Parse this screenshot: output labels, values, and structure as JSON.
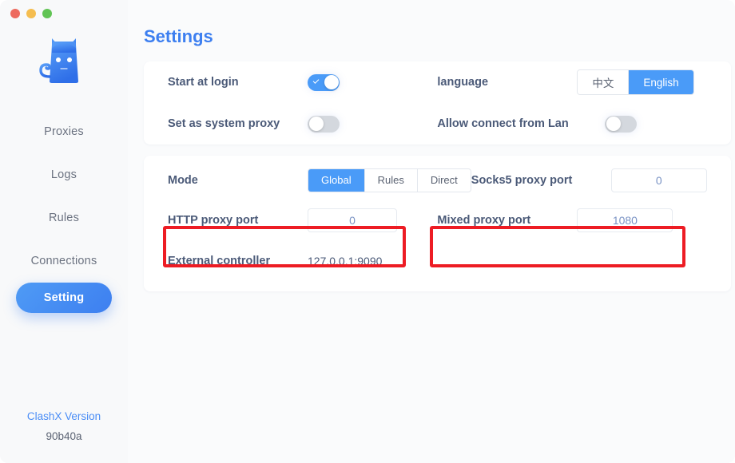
{
  "window": {
    "traffic_lights": [
      {
        "name": "close",
        "color": "#ed6a5e"
      },
      {
        "name": "minimize",
        "color": "#f5bd4f"
      },
      {
        "name": "zoom",
        "color": "#61c454"
      }
    ]
  },
  "sidebar": {
    "logo": "clashx-cat-logo",
    "items": [
      {
        "label": "Proxies",
        "active": false
      },
      {
        "label": "Logs",
        "active": false
      },
      {
        "label": "Rules",
        "active": false
      },
      {
        "label": "Connections",
        "active": false
      },
      {
        "label": "Setting",
        "active": true
      }
    ],
    "version_label": "ClashX Version",
    "version_hash": "90b40a"
  },
  "main": {
    "title": "Settings",
    "card_general": {
      "rows": [
        {
          "left": {
            "label": "Start at login",
            "control": "toggle",
            "value": "on"
          },
          "right": {
            "label": "language",
            "control": "segmented",
            "options": [
              "中文",
              "English"
            ],
            "selected": "English"
          }
        },
        {
          "left": {
            "label": "Set as system proxy",
            "control": "toggle",
            "value": "off"
          },
          "right": {
            "label": "Allow connect from Lan",
            "control": "toggle",
            "value": "off"
          }
        }
      ]
    },
    "card_proxy": {
      "rows": [
        {
          "left": {
            "label": "Mode",
            "control": "segmented",
            "options": [
              "Global",
              "Rules",
              "Direct"
            ],
            "selected": "Global"
          },
          "right": {
            "label": "Socks5 proxy port",
            "control": "input",
            "value": "0"
          }
        },
        {
          "left": {
            "label": "HTTP proxy port",
            "control": "input",
            "value": "0",
            "highlighted": true
          },
          "right": {
            "label": "Mixed proxy port",
            "control": "input",
            "value": "1080",
            "highlighted": true
          }
        },
        {
          "left": {
            "label": "External controller",
            "control": "static",
            "value": "127.0.0.1:9090"
          },
          "right": {
            "label": "",
            "control": "none",
            "value": ""
          }
        }
      ]
    }
  },
  "colors": {
    "accent": "#4a9bf8",
    "title_blue": "#3d7ff0",
    "label_text": "#4b5a78",
    "annotation_red": "#ed1c24",
    "input_text": "#7a93c4"
  }
}
